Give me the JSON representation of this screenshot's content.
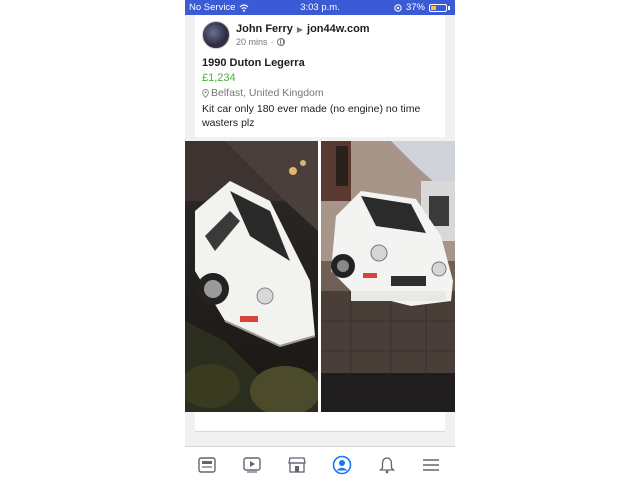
{
  "status_bar": {
    "carrier": "No Service",
    "time": "3:03 p.m.",
    "battery": "37%",
    "battery_level": 0.37,
    "icons": [
      "wifi-icon",
      "location-icon",
      "battery-icon"
    ]
  },
  "post": {
    "author": "John Ferry",
    "group": "jon44w.com",
    "time_ago": "20 mins",
    "visibility_icon": "globe-icon",
    "title": "1990 Duton Legerra",
    "price": "£1,234",
    "location": "Belfast, United Kingdom",
    "description": "Kit car only 180 ever made (no engine) no time wasters plz",
    "photos": [
      "car-photo-front-left",
      "car-photo-front"
    ]
  },
  "tab_bar": {
    "items": [
      "news-feed-icon",
      "watch-icon",
      "marketplace-icon",
      "profile-icon",
      "notifications-icon",
      "menu-icon"
    ],
    "active": "profile-icon"
  },
  "colors": {
    "status_bar": "#3b5bd6",
    "price": "#4caf3c",
    "active_tab": "#1877f2",
    "inactive_tab": "#606770"
  }
}
